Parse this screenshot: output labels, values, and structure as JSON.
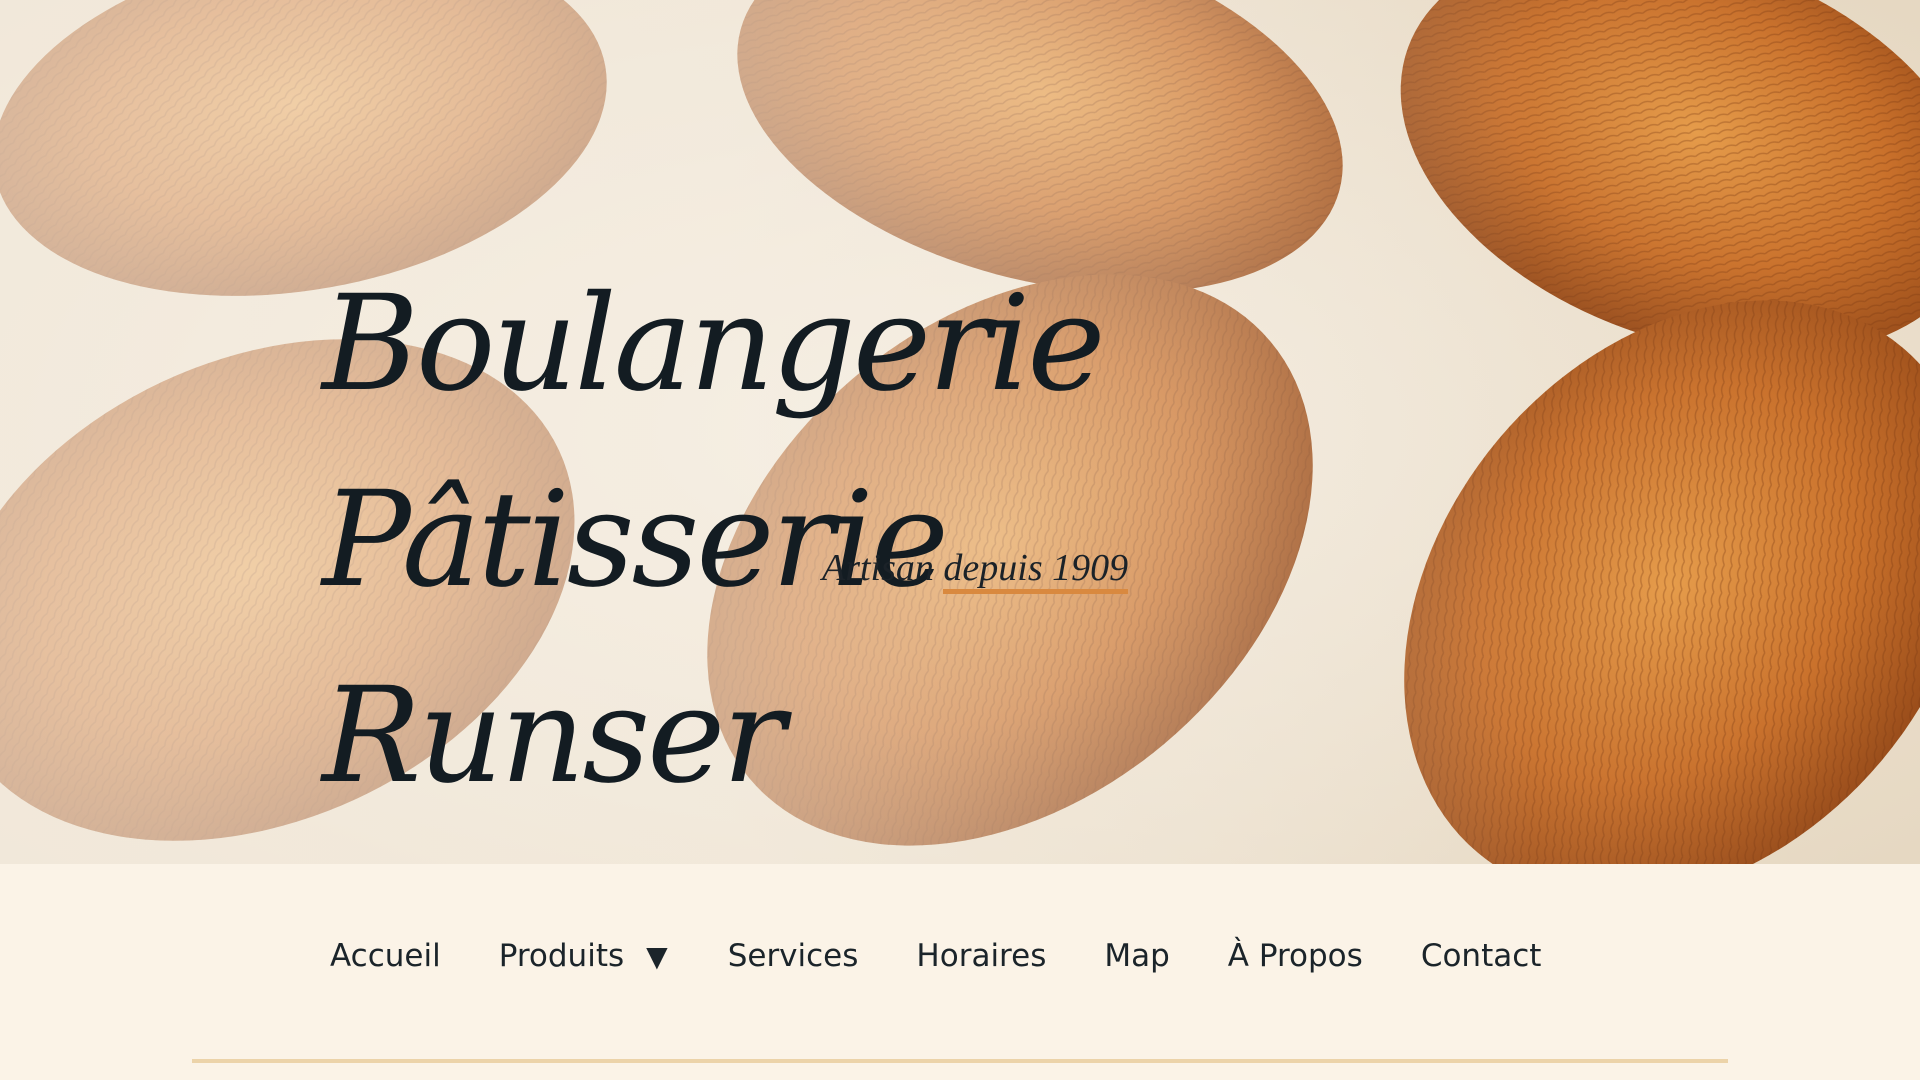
{
  "hero": {
    "title_line1": "Boulangerie Pâtisserie",
    "title_line2": "Runser",
    "tagline_prefix": "Artisan ",
    "tagline_accent": "depuis 1909",
    "background_image": "croissants-photo"
  },
  "nav": {
    "items": [
      {
        "label": "Accueil"
      },
      {
        "label": "Produits",
        "icon": "caret-down-icon",
        "caret": "▼"
      },
      {
        "label": "Services"
      },
      {
        "label": "Horaires"
      },
      {
        "label": "Map"
      },
      {
        "label": "À Propos"
      },
      {
        "label": "Contact"
      }
    ]
  },
  "colors": {
    "text": "#131c22",
    "accent": "#d9893f",
    "nav_background": "#fbf3e7",
    "rule": "#ecd3a9"
  }
}
